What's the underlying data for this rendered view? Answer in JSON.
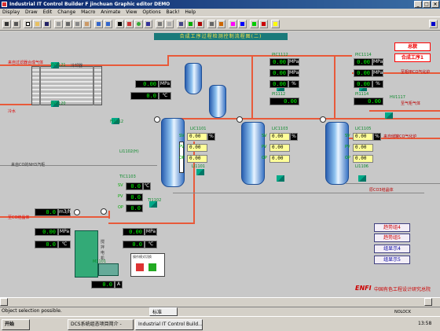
{
  "window": {
    "title": "Industrial IT Control Builder F jinchuan  Graphic editor  DEMO",
    "min": "_",
    "max": "□",
    "close": "×"
  },
  "menu": [
    "Display",
    "Draw",
    "Edit",
    "Change",
    "Macro",
    "Animate",
    "View",
    "Options",
    "Back!",
    "Help"
  ],
  "canvas": {
    "header": "合成工序过程检测控制流程图(二)",
    "btn_total": "总貌",
    "btn_synth": "合成工序1",
    "nav": [
      "趋势组4",
      "趋势组5",
      "组显示4",
      "组显示5"
    ],
    "tags": {
      "xv1121": "XV1121",
      "xv1120": "XV1120",
      "lc1110": "LIC1110",
      "pic1112": "PIC1112",
      "pi1112": "PI1112",
      "li1106": "LI1106",
      "lic1103": "LIC1103",
      "li1101": "LI1101",
      "pic1114": "PIC1114",
      "pi1114": "PI1114",
      "lic1105": "LIC1105",
      "hv1117": "HV1117",
      "lic1101": "LIC1101",
      "tic1103": "TIC1103",
      "fi1101": "FI1101",
      "fi1112": "FI1112",
      "ti1102": "TI1102",
      "m1101": "M1101",
      "li1102": "LI1102(H)"
    },
    "labels": {
      "water_in": "来自过滤器合成气体",
      "water": "冷水",
      "cooler": "冷却器",
      "to_synth": "至粗甲CO气化炉",
      "tail_gas": "至气柜气体",
      "from_tank": "来自储罐CO气化炉",
      "feed": "来自CO的NH3汽柜",
      "co2": "原CO3结晶体",
      "from_co": "至CO结晶体",
      "nh3_in": "来自NH3汽柜"
    },
    "readings": {
      "v1": "0.00",
      "u1": "MPa",
      "v2": "0.0",
      "u2": "℃",
      "p1112": "0.00",
      "pu1112": "MPa",
      "p1112b": "0.00",
      "pu1112b": "MPa",
      "p1112c": "0.00",
      "pu1112c": "%",
      "p1114": "0.00",
      "pu1114": "MPa",
      "p1114b": "0.00",
      "pu1114b": "MPa",
      "p1114c": "0.00",
      "pu1114c": "%",
      "l1101a": "0.00",
      "l1101b": "0.00",
      "l1101c": "0.00",
      "l1101u": "%",
      "l1103a": "0.00",
      "l1103b": "0.00",
      "l1103c": "0.00",
      "l1103u": "%",
      "l1105a": "0.00",
      "l1105b": "0.00",
      "l1105c": "0.00",
      "l1105u": "%",
      "t1103a": "0.0",
      "t1103b": "0.0",
      "t1103c": "0.0",
      "t1103u": "℃",
      "f1101": "0.0",
      "f1101u": "m3/h",
      "pa": "0.00",
      "pau": "MPa",
      "pb": "0.0",
      "pbu": "℃",
      "pc": "0.00",
      "pcu": "MPa",
      "pd": "0.0",
      "pdu": "℃",
      "amp": "0.0",
      "ampu": "A"
    },
    "pv_labels": [
      "SV",
      "PV",
      "OP"
    ],
    "panel_label": "操作模式切换",
    "motor_label": "搅拌电机",
    "company": "中国有色工程设计研究总院",
    "logo": "ENFI"
  },
  "status": {
    "text": "Object selection possible."
  },
  "taskbar": {
    "start": "开始",
    "tasks": [
      "DCS系统组态项目简介 -",
      "Industrial IT Control Build..."
    ],
    "ime": "标准",
    "time": "13:58",
    "nolock": "NOLOCK"
  }
}
